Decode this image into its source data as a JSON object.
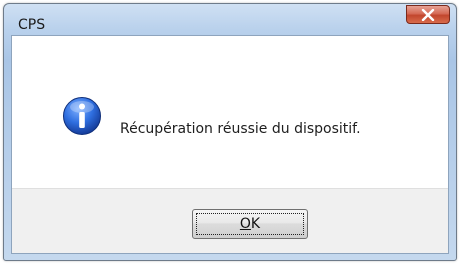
{
  "window": {
    "title": "CPS"
  },
  "dialog": {
    "icon": "info-icon",
    "message": "Récupération réussie du dispositif.",
    "ok_button": {
      "mnemonic": "O",
      "rest": "K"
    }
  },
  "colors": {
    "close_button": "#c2462d",
    "info_icon_blue": "#1c57c5",
    "footer_bg": "#f0f0f0"
  }
}
